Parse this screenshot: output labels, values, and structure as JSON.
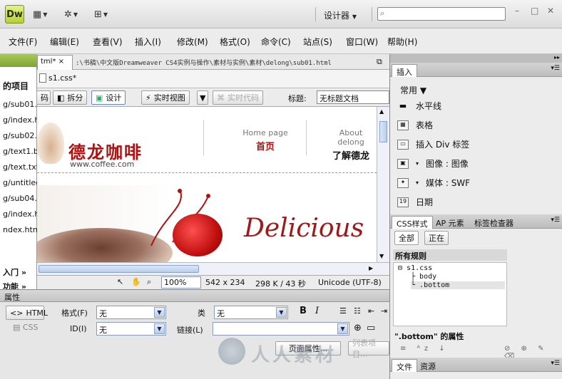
{
  "app": {
    "logo": "Dw",
    "workspace": "设计器",
    "window_controls": [
      "–",
      "□",
      "✕"
    ]
  },
  "menu": [
    "文件(F)",
    "编辑(E)",
    "查看(V)",
    "插入(I)",
    "修改(M)",
    "格式(O)",
    "命令(C)",
    "站点(S)",
    "窗口(W)",
    "帮助(H)"
  ],
  "left_panel": {
    "heading": "的项目",
    "links": [
      "g/sub01.",
      "g/index.h",
      "g/sub02.",
      "g/text1.b",
      "g/text.txt",
      "g/untitled",
      "g/sub04.",
      "g/index.h",
      "ndex.htm"
    ],
    "footer": [
      "入门 »",
      "功能 »"
    ]
  },
  "document": {
    "tab": "tml*",
    "path": ":\\书稿\\中文版Dreamweaver CS4实例与操作\\素材与实例\\素材\\delong\\sub01.html",
    "related_file": "s1.css*",
    "buttons": {
      "code": "码",
      "split": "拆分",
      "design": "设计",
      "live": "实时视图",
      "livecode": "实时代码"
    },
    "title_label": "标题:",
    "title_value": "无标题文档"
  },
  "page": {
    "brand": "德龙咖啡",
    "url": "www.coffee.com",
    "nav": [
      {
        "en": "Home page",
        "cn": "首页"
      },
      {
        "en": "About delong",
        "cn": "了解德龙"
      }
    ],
    "banner_text": "Delicious"
  },
  "statusbar": {
    "zoom": "100%",
    "size": "542 x 234",
    "filesize": "298 K / 43 秒",
    "encoding": "Unicode (UTF-8)"
  },
  "properties": {
    "title": "属性",
    "html_btn": "HTML",
    "css_btn": "CSS",
    "format_label": "格式(F)",
    "format_value": "无",
    "id_label": "ID(I)",
    "id_value": "无",
    "class_label": "类",
    "class_value": "无",
    "link_label": "链接(L)",
    "link_value": "",
    "page_props_btn": "页面属性...",
    "list_btn": "列表项目..."
  },
  "insert_panel": {
    "tab": "插入",
    "category": "常用",
    "items": [
      "水平线",
      "表格",
      "插入 Div 标签",
      "图像 : 图像",
      "媒体 : SWF",
      "日期"
    ]
  },
  "css_panel": {
    "tabs": [
      "CSS样式",
      "AP 元素",
      "标签检查器"
    ],
    "modes": [
      "全部",
      "正在"
    ],
    "section": "所有规则",
    "rules": [
      "s1.css",
      "body",
      ".bottom"
    ],
    "props_title": "\".bottom\" 的属性"
  },
  "files_panel": {
    "tabs": [
      "文件",
      "资源"
    ]
  },
  "watermark": "人人素材",
  "colors": {
    "accent": "#b01010",
    "dw_green": "#b8cf3a"
  }
}
